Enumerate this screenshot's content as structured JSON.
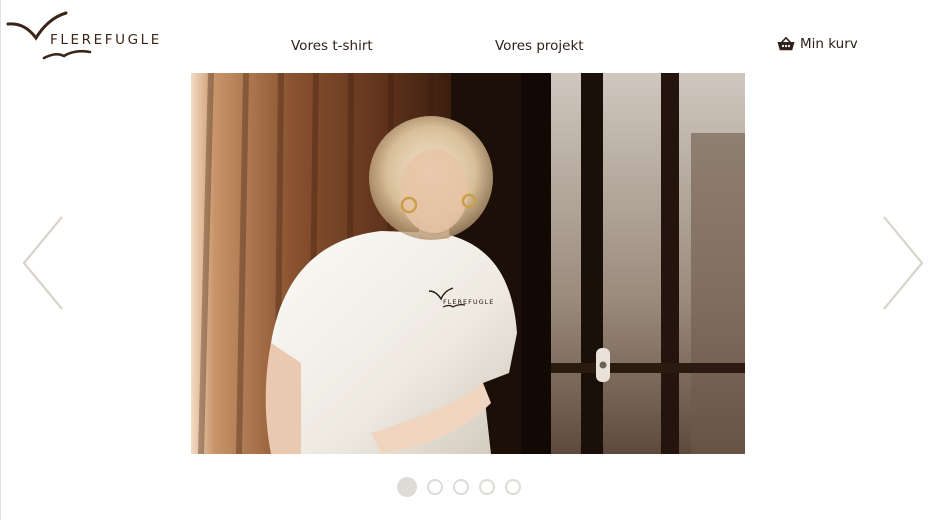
{
  "logo": {
    "text": "FLEREFUGLE",
    "color": "#3d2418"
  },
  "nav": {
    "items": [
      {
        "label": "Vores t-shirt"
      },
      {
        "label": "Vores projekt"
      }
    ],
    "cart_label": "Min kurv",
    "cart_icon": "basket-icon"
  },
  "carousel": {
    "prev_icon": "chevron-left-icon",
    "next_icon": "chevron-right-icon",
    "slide_count": 5,
    "active_slide": 1,
    "shirt_print": "FLEREFUGLE",
    "arrow_color": "#d8d4cc"
  }
}
